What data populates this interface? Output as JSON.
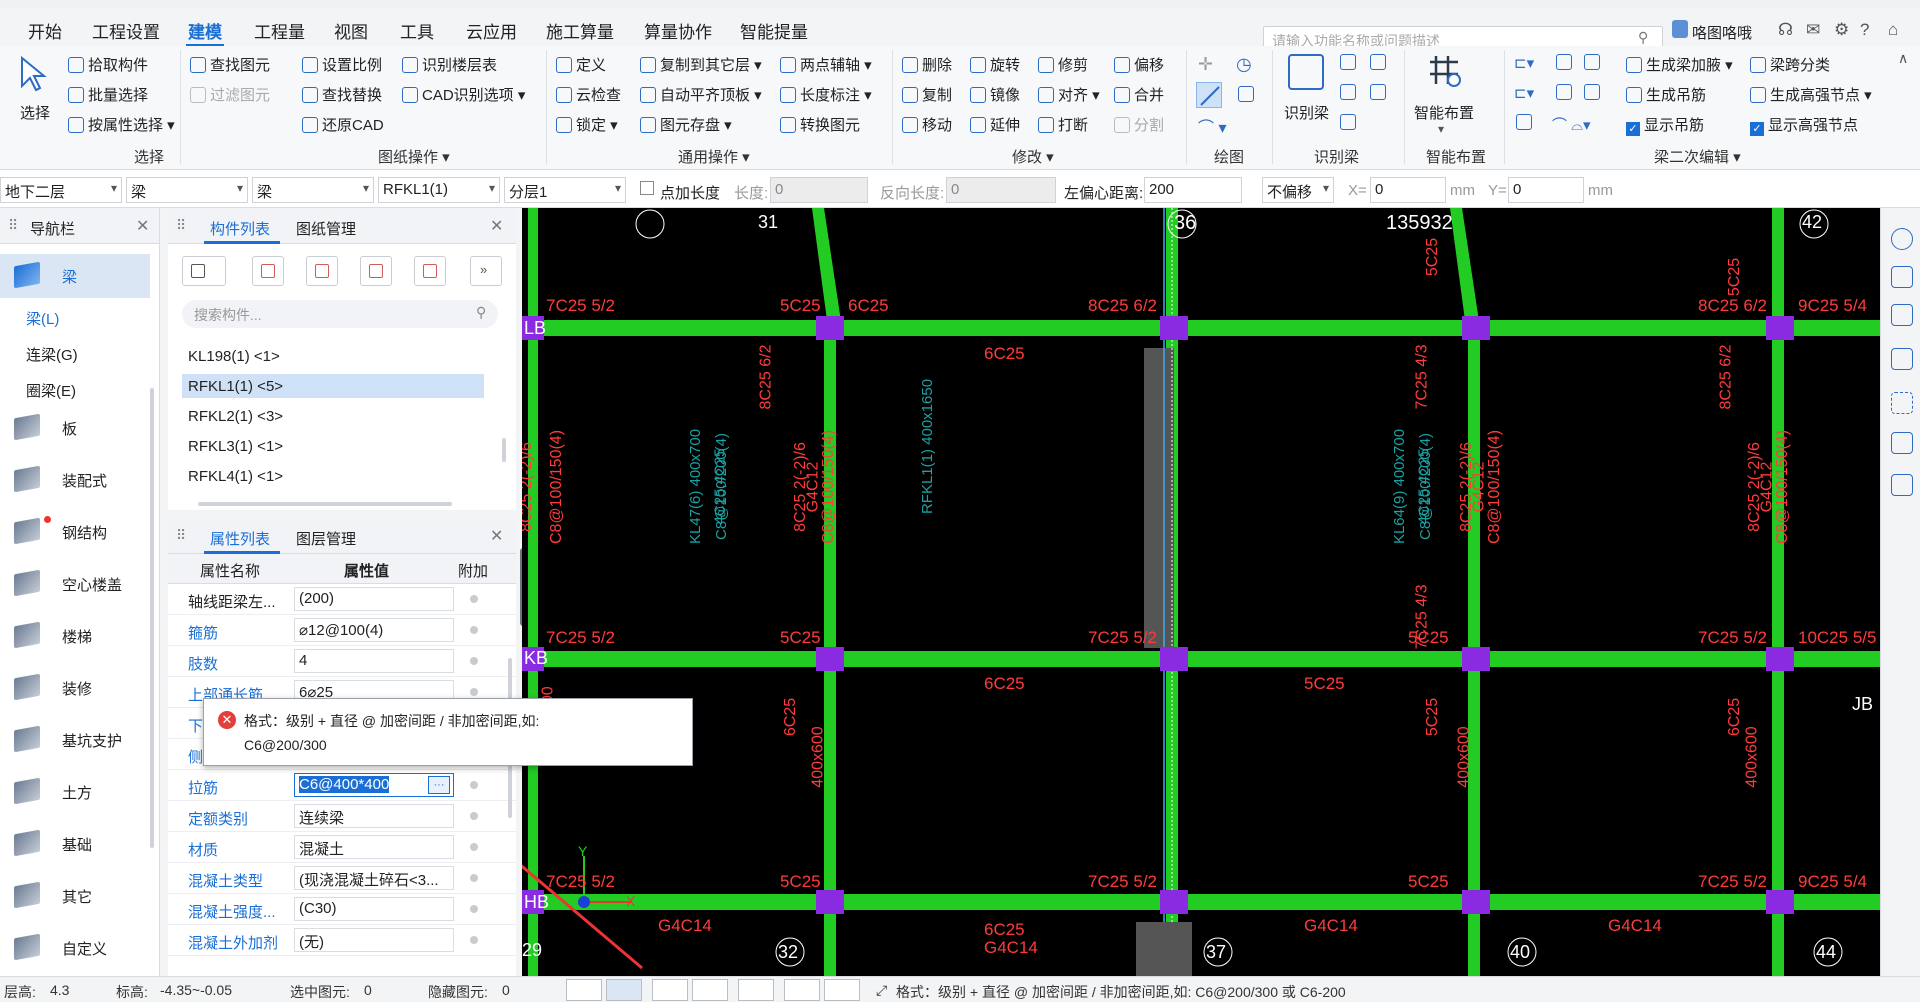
{
  "menu": {
    "items": [
      "开始",
      "工程设置",
      "建模",
      "工程量",
      "视图",
      "工具",
      "云应用",
      "施工算量",
      "算量协作",
      "智能提量"
    ],
    "active": "建模",
    "search_placeholder": "请输入功能名称或问题描述",
    "user": "咯图咯哦"
  },
  "ribbon": {
    "select_group": {
      "big": "选择",
      "items": [
        "拾取构件",
        "批量选择",
        "按属性选择"
      ],
      "label": "选择"
    },
    "drawing_ops": {
      "items": [
        "查找图元",
        "过滤图元",
        "设置比例",
        "查找替换",
        "还原CAD",
        "识别楼层表",
        "CAD识别选项"
      ],
      "label": "图纸操作"
    },
    "general_ops": {
      "items": [
        "定义",
        "云检查",
        "锁定",
        "复制到其它层",
        "自动平齐顶板",
        "图元存盘",
        "两点辅轴",
        "长度标注",
        "转换图元"
      ],
      "label": "通用操作"
    },
    "modify": {
      "items": [
        "删除",
        "旋转",
        "修剪",
        "偏移",
        "复制",
        "镜像",
        "对齐",
        "合并",
        "移动",
        "延伸",
        "打断",
        "分割"
      ],
      "label": "修改"
    },
    "draw": {
      "label": "绘图"
    },
    "identify": {
      "big": "识别梁",
      "label": "识别梁"
    },
    "smart": {
      "big": "智能布置",
      "label": "智能布置"
    },
    "beam2": {
      "items": [
        "生成梁加腋",
        "梁跨分类",
        "生成吊筋",
        "生成高强节点",
        "显示吊筋",
        "显示高强节点"
      ],
      "label": "梁二次编辑"
    }
  },
  "propbar": {
    "floor": "地下二层",
    "type1": "梁",
    "type2": "梁",
    "component": "RFKL1(1)",
    "layer": "分层1",
    "add_length_label": "点加长度",
    "length_label": "长度:",
    "length_value": "0",
    "rev_length_label": "反向长度:",
    "rev_length_value": "0",
    "left_offset_label": "左偏心距离:",
    "left_offset_value": "200",
    "offset_mode": "不偏移",
    "x_label": "X=",
    "x_value": "0",
    "y_label": "Y=",
    "y_value": "0",
    "unit": "mm"
  },
  "nav": {
    "title": "导航栏",
    "items": [
      {
        "label": "梁"
      },
      {
        "label": "板"
      },
      {
        "label": "装配式"
      },
      {
        "label": "钢结构"
      },
      {
        "label": "空心楼盖"
      },
      {
        "label": "楼梯"
      },
      {
        "label": "装修"
      },
      {
        "label": "基坑支护"
      },
      {
        "label": "土方"
      },
      {
        "label": "基础"
      },
      {
        "label": "其它"
      },
      {
        "label": "自定义"
      }
    ],
    "subitems": [
      "梁(L)",
      "连梁(G)",
      "圈梁(E)"
    ]
  },
  "complist": {
    "tabs": [
      "构件列表",
      "图纸管理"
    ],
    "search_placeholder": "搜索构件...",
    "items": [
      "KL198(1) <1>",
      "RFKL1(1) <5>",
      "RFKL2(1) <3>",
      "RFKL3(1) <1>",
      "RFKL4(1) <1>"
    ]
  },
  "proplist": {
    "tabs": [
      "属性列表",
      "图层管理"
    ],
    "headers": [
      "属性名称",
      "属性值",
      "附加"
    ],
    "rows": [
      {
        "name": "轴线距梁左...",
        "value": "(200)",
        "link": false
      },
      {
        "name": "箍筋",
        "value": "⌀12@100(4)",
        "link": true
      },
      {
        "name": "肢数",
        "value": "4",
        "link": true
      },
      {
        "name": "上部通长筋",
        "value": "6⌀25",
        "link": true
      },
      {
        "name": "下部通长筋",
        "value": "",
        "link": true
      },
      {
        "name": "侧面构造或...",
        "value": "",
        "link": true
      },
      {
        "name": "拉筋",
        "value": "C6@400*400",
        "link": true
      },
      {
        "name": "定额类别",
        "value": "连续梁",
        "link": true
      },
      {
        "name": "材质",
        "value": "混凝土",
        "link": true
      },
      {
        "name": "混凝土类型",
        "value": "(现浇混凝土碎石<3...",
        "link": true
      },
      {
        "name": "混凝土强度...",
        "value": "(C30)",
        "link": true
      },
      {
        "name": "混凝土外加剂",
        "value": "(无)",
        "link": true
      }
    ]
  },
  "tooltip": {
    "line1": "格式：级别 + 直径 @ 加密间距 / 非加密间距,如:",
    "line2": "C6@200/300"
  },
  "canvas": {
    "axis_top": [
      "31",
      "36",
      "135932",
      "42"
    ],
    "axis_bottom": [
      "29",
      "32",
      "37",
      "40",
      "44"
    ],
    "axis_left": [
      "LB",
      "KB",
      "HB"
    ],
    "axis_right": [
      "JB"
    ],
    "labels_row1": [
      "7C25 5/2",
      "5C25",
      "6C25",
      "8C25 6/2",
      "8C25 6/2",
      "9C25 5/4"
    ],
    "labels_row2": [
      "7C25 5/2",
      "5C25",
      "7C25 5/2",
      "5C25",
      "7C25 5/2",
      "10C25 5/5"
    ],
    "labels_row3": [
      "7C25 5/2",
      "5C25",
      "7C25 5/2",
      "5C25",
      "7C25 5/2",
      "9C25 5/4"
    ],
    "mid_labels": [
      "6C25",
      "6C25",
      "5C25"
    ],
    "bottom_labels": [
      "G4C14",
      "6C25",
      "G4C14",
      "G4C14",
      "G4C14"
    ],
    "vertical_red": [
      "8C25 2(-2)/6",
      "C8@100/150(4)",
      "G4C12",
      "400x600",
      "8C25 6/2",
      "7C25 4/3",
      "5C25",
      "6C25"
    ],
    "vertical_cyan": [
      "KL47(6) 400x700",
      "C8@100/200(4)",
      "4C25;4C25",
      "RFKL1(1) 400x1650",
      "KL64(9) 400x700"
    ],
    "colors": {
      "beam": "#22cc22",
      "node": "#8a2be2",
      "red_text": "#ff3b3b",
      "cyan_text": "#1aa3a3"
    }
  },
  "status": {
    "floor_height_label": "层高:",
    "floor_height": "4.3",
    "elevation_label": "标高:",
    "elevation": "-4.35~-0.05",
    "selected_label": "选中图元:",
    "selected": "0",
    "hidden_label": "隐藏图元:",
    "hidden": "0",
    "hint": "格式：级别 + 直径 @ 加密间距 / 非加密间距,如: C6@200/300 或 C6-200"
  }
}
